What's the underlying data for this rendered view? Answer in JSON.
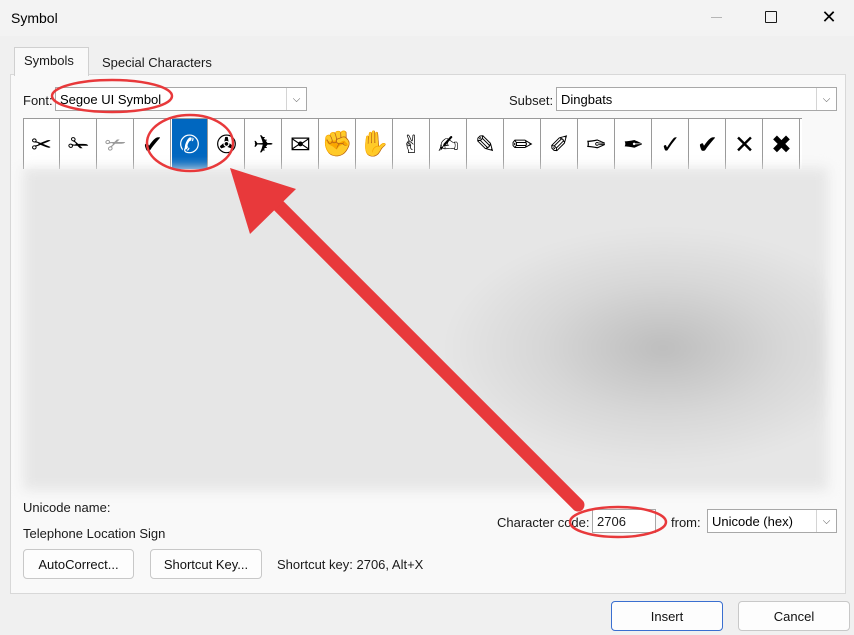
{
  "window": {
    "title": "Symbol",
    "close_glyph": "✕"
  },
  "tabs": [
    {
      "label": "Symbols"
    },
    {
      "label": "Special Characters"
    }
  ],
  "font": {
    "label": "Font:",
    "value": "Segoe UI Symbol"
  },
  "subset": {
    "label": "Subset:",
    "value": "Dingbats"
  },
  "symbols": [
    {
      "glyph": "✂",
      "name": "black-scissors"
    },
    {
      "glyph": "✁",
      "name": "upper-blade-scissors"
    },
    {
      "glyph": "✃",
      "name": "lower-blade-scissors"
    },
    {
      "glyph": "✔",
      "name": "check-outline"
    },
    {
      "glyph": "✆",
      "name": "telephone-location-sign",
      "selected": true
    },
    {
      "glyph": "✇",
      "name": "tape-drive"
    },
    {
      "glyph": "✈",
      "name": "airplane"
    },
    {
      "glyph": "✉",
      "name": "envelope"
    },
    {
      "glyph": "✊",
      "name": "raised-fist"
    },
    {
      "glyph": "✋",
      "name": "raised-hand"
    },
    {
      "glyph": "✌",
      "name": "victory-hand"
    },
    {
      "glyph": "✍",
      "name": "writing-hand"
    },
    {
      "glyph": "✎",
      "name": "pencil"
    },
    {
      "glyph": "✏",
      "name": "pencil-horizontal"
    },
    {
      "glyph": "✐",
      "name": "pencil-upper-right"
    },
    {
      "glyph": "✑",
      "name": "white-nib"
    },
    {
      "glyph": "✒",
      "name": "black-nib"
    },
    {
      "glyph": "✓",
      "name": "check-mark"
    },
    {
      "glyph": "✔",
      "name": "heavy-check-mark"
    },
    {
      "glyph": "✕",
      "name": "multiplication-x"
    },
    {
      "glyph": "✖",
      "name": "heavy-multiplication-x"
    }
  ],
  "unicode_name": {
    "label": "Unicode name:",
    "value": "Telephone Location Sign"
  },
  "character_code": {
    "label": "Character code:",
    "value": "2706"
  },
  "from": {
    "label": "from:",
    "value": "Unicode (hex)"
  },
  "buttons": {
    "autocorrect": "AutoCorrect...",
    "shortcut_key": "Shortcut Key...",
    "insert": "Insert",
    "cancel": "Cancel"
  },
  "shortcut_info": "Shortcut key: 2706, Alt+X",
  "colors": {
    "annotation": "#e8393b",
    "selection": "#0067c0"
  }
}
